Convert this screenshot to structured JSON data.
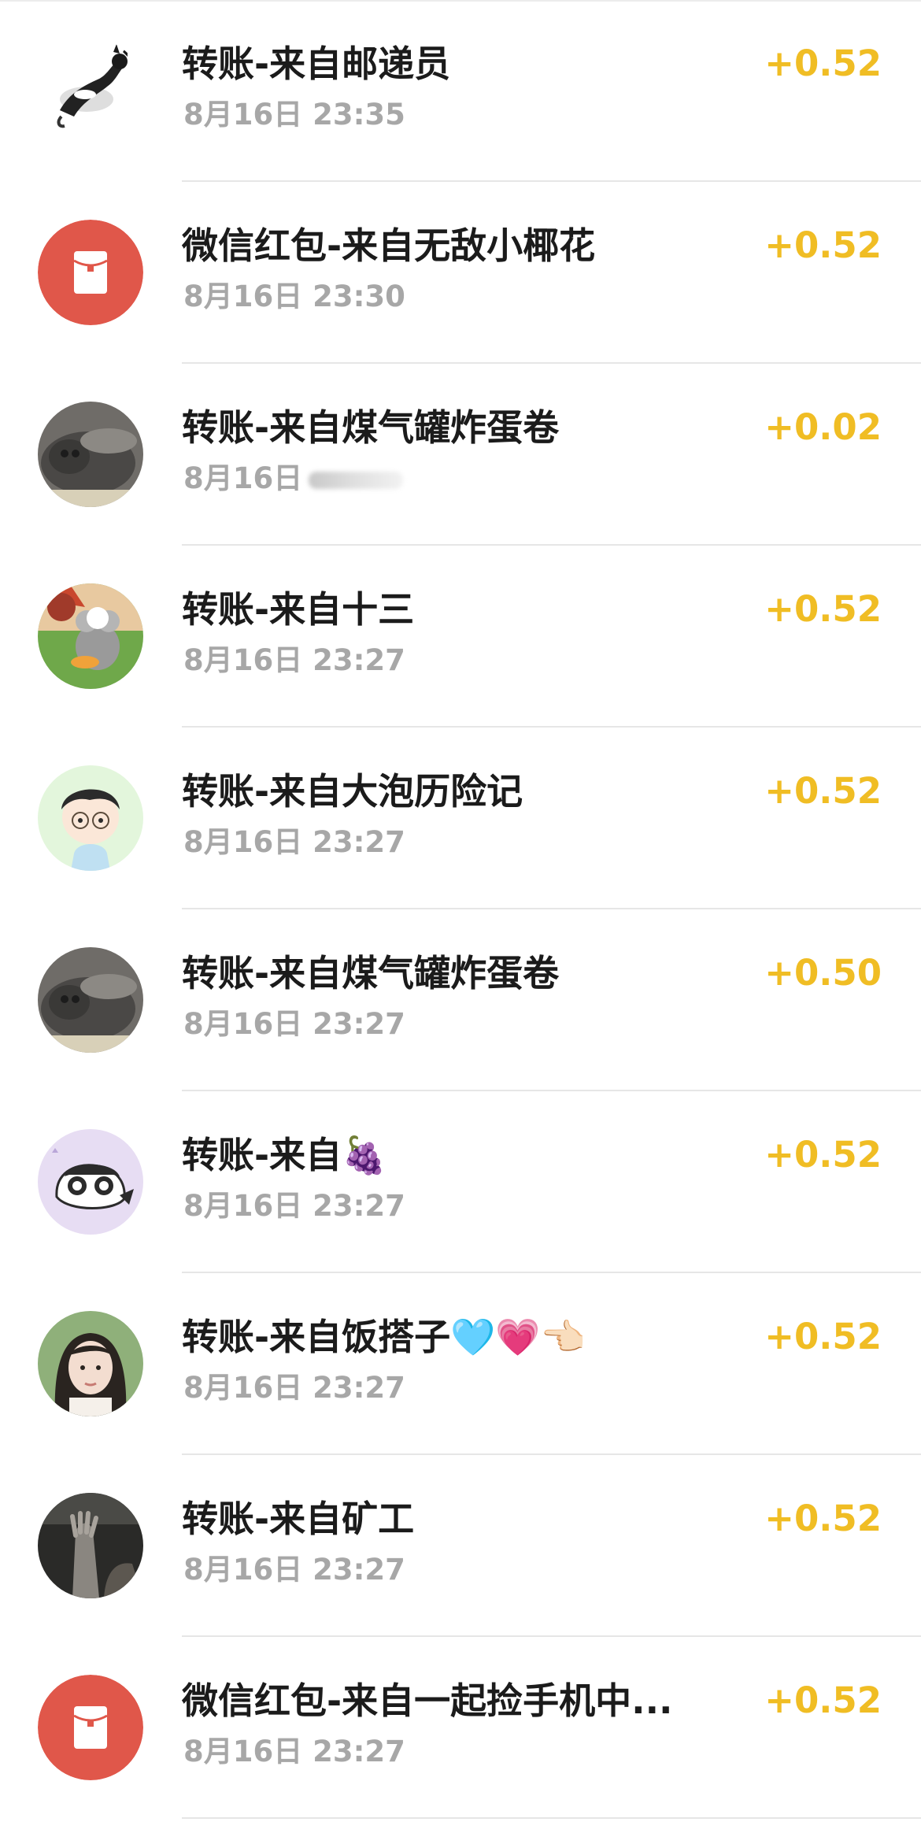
{
  "transactions": [
    {
      "title": "转账-来自邮递员",
      "time": "8月16日 23:35",
      "amount": "+0.52",
      "avatar": "ink-cat-avatar"
    },
    {
      "title": "微信红包-来自无敌小椰花",
      "time": "8月16日 23:30",
      "amount": "+0.52",
      "avatar": "red-packet-icon"
    },
    {
      "title": "转账-来自煤气罐炸蛋卷",
      "time": "8月16日",
      "amount": "+0.02",
      "avatar": "gray-cat-avatar"
    },
    {
      "title": "转账-来自十三",
      "time": "8月16日 23:27",
      "amount": "+0.52",
      "avatar": "cartoon-mouse-avatar"
    },
    {
      "title": "转账-来自大泡历险记",
      "time": "8月16日 23:27",
      "amount": "+0.52",
      "avatar": "cartoon-boy-avatar"
    },
    {
      "title": "转账-来自煤气罐炸蛋卷",
      "time": "8月16日 23:27",
      "amount": "+0.50",
      "avatar": "gray-cat-avatar"
    },
    {
      "title": "转账-来自🍇",
      "time": "8月16日 23:27",
      "amount": "+0.52",
      "avatar": "cartoon-cat-avatar"
    },
    {
      "title": "转账-来自饭搭子🩵💗👈🏻",
      "time": "8月16日 23:27",
      "amount": "+0.52",
      "avatar": "girl-photo-avatar"
    },
    {
      "title": "转账-来自矿工",
      "time": "8月16日 23:27",
      "amount": "+0.52",
      "avatar": "dark-photo-avatar"
    },
    {
      "title": "微信红包-来自一起捡手机中...",
      "time": "8月16日 23:27",
      "amount": "+0.52",
      "avatar": "red-packet-icon"
    }
  ],
  "colors": {
    "amount": "#f0bd24",
    "title": "#1b1b1b",
    "time": "#a7a7a7",
    "red_packet": "#e0574a"
  }
}
